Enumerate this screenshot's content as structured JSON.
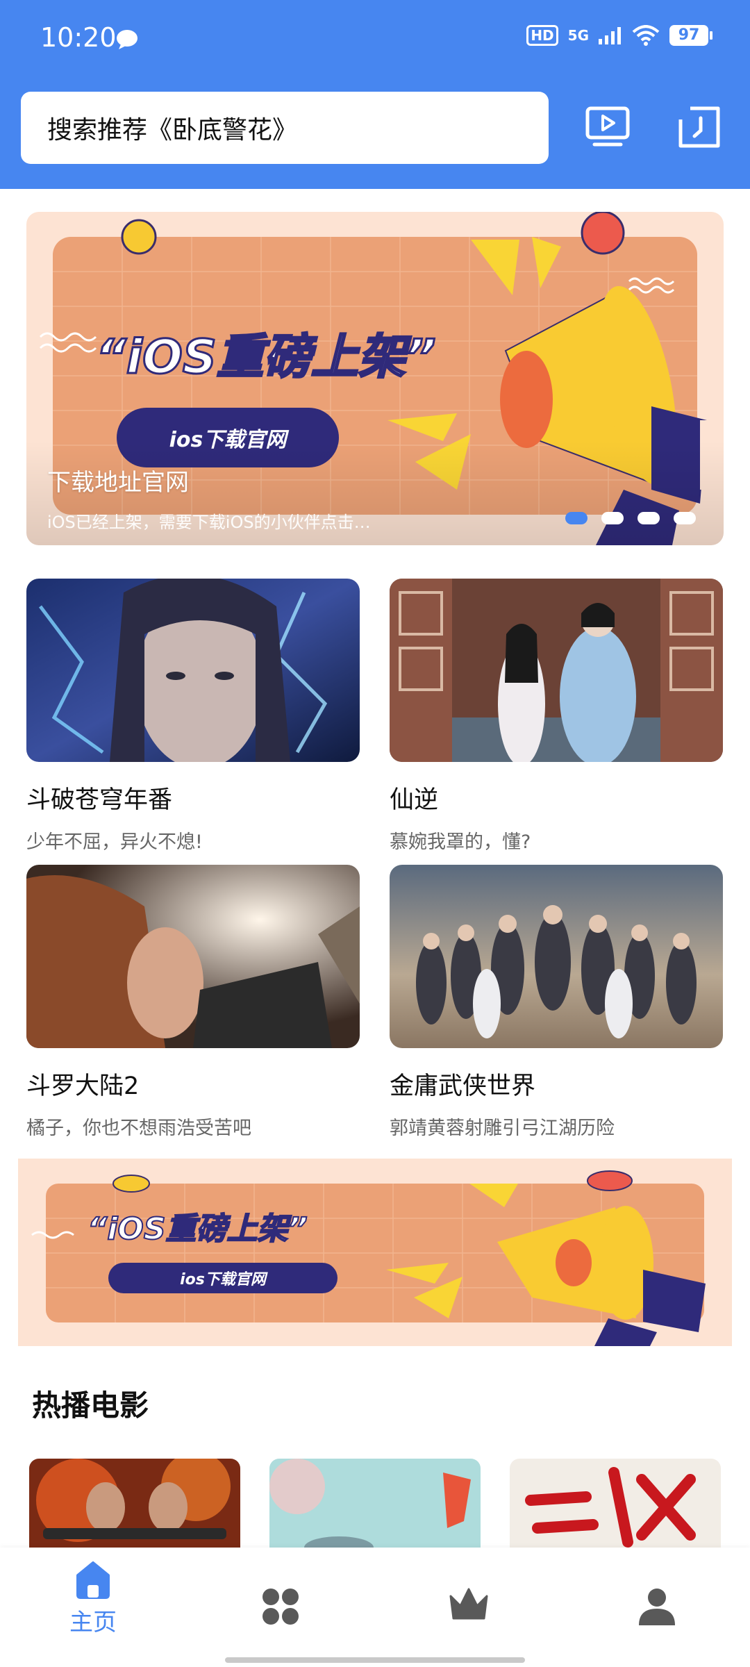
{
  "status_bar": {
    "time": "10:20",
    "hd": "HD",
    "network": "5G",
    "battery": "97"
  },
  "search": {
    "placeholder": "搜索推荐《卧底警花》"
  },
  "banner": {
    "headline": "“iOS重磅上架”",
    "button_text": "ios下载官网",
    "title": "下载地址官网",
    "description": "iOS已经上架，需要下载iOS的小伙伴点击…",
    "page_count": 4,
    "active_index": 0
  },
  "cards": [
    {
      "title": "斗破苍穹年番",
      "subtitle": "少年不屈，异火不熄!"
    },
    {
      "title": "仙逆",
      "subtitle": "慕婉我罩的，懂?"
    },
    {
      "title": "斗罗大陆2",
      "subtitle": "橘子，你也不想雨浩受苦吧"
    },
    {
      "title": "金庸武侠世界",
      "subtitle": "郭靖黄蓉射雕引弓江湖历险"
    }
  ],
  "banner2": {
    "headline": "“iOS重磅上架”",
    "button_text": "ios下载官网"
  },
  "hot_movies": {
    "title": "热播电影"
  },
  "bottom_nav": {
    "items": [
      {
        "label": "主页",
        "icon": "home-icon",
        "active": true
      },
      {
        "label": "",
        "icon": "category-icon",
        "active": false
      },
      {
        "label": "",
        "icon": "crown-icon",
        "active": false
      },
      {
        "label": "",
        "icon": "profile-icon",
        "active": false
      }
    ]
  },
  "colors": {
    "primary": "#4786f0",
    "banner_orange": "#eca77b",
    "text_secondary": "#666666"
  }
}
